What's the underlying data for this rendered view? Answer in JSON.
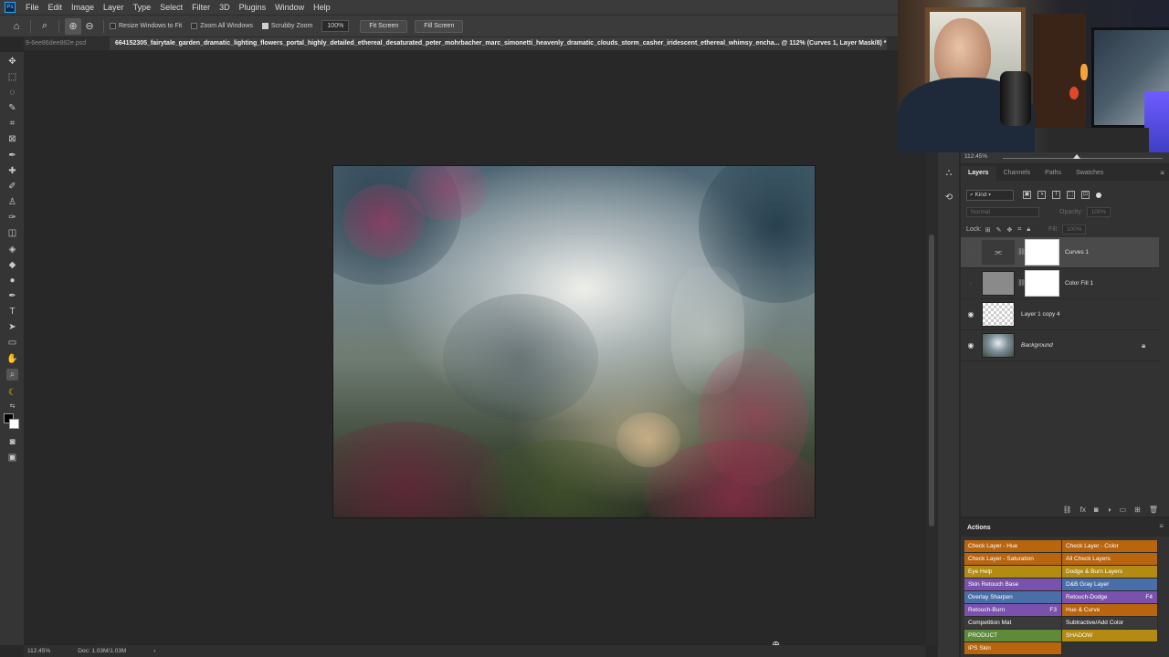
{
  "menu": [
    "File",
    "Edit",
    "Image",
    "Layer",
    "Type",
    "Select",
    "Filter",
    "3D",
    "Plugins",
    "Window",
    "Help"
  ],
  "options_bar": {
    "resize_windows": "Resize Windows to Fit",
    "zoom_all": "Zoom All Windows",
    "scrubby_zoom": "Scrubby Zoom",
    "zoom_value": "100%",
    "fit_screen": "Fit Screen",
    "fill_screen": "Fill Screen"
  },
  "tabs": {
    "inactive": "9-6ee86dee882e.psd",
    "active": "664152305_fairytale_garden_dramatic_lighting_flowers_portal_highly_detailed_ethereal_desaturated_peter_mohrbacher_marc_simonetti_heavenly_dramatic_clouds_storm_casher_iridescent_ethereal_whimsy_encha... @ 112% (Curves 1, Layer Mask/8) *"
  },
  "navigator": {
    "zoom": "112.45%"
  },
  "layers_panel": {
    "tabs": [
      "Layers",
      "Channels",
      "Paths",
      "Swatches"
    ],
    "filter_kind": "Kind",
    "blend_mode": "Normal",
    "opacity_label": "Opacity:",
    "opacity_value": "100%",
    "lock_label": "Lock:",
    "fill_label": "Fill:",
    "fill_value": "100%",
    "layers": [
      {
        "name": "Curves 1"
      },
      {
        "name": "Color Fill 1"
      },
      {
        "name": "Layer 1 copy 4"
      },
      {
        "name": "Background"
      }
    ]
  },
  "actions_panel": {
    "title": "Actions",
    "buttons": [
      {
        "label": "Check Layer - Hue",
        "key": "",
        "color": "#b8650e"
      },
      {
        "label": "Check Layer - Color",
        "key": "",
        "color": "#b8650e"
      },
      {
        "label": "Check Layer - Saturation",
        "key": "",
        "color": "#b8650e"
      },
      {
        "label": "All Check Layers",
        "key": "",
        "color": "#b8650e"
      },
      {
        "label": "Eye Help",
        "key": "",
        "color": "#b38a12"
      },
      {
        "label": "Dodge & Burn Layers",
        "key": "",
        "color": "#b38a12"
      },
      {
        "label": "Skin Retouch Base",
        "key": "",
        "color": "#7a52ad"
      },
      {
        "label": "D&B Gray Layer",
        "key": "",
        "color": "#4a6ea8"
      },
      {
        "label": "Overlay Sharpen",
        "key": "",
        "color": "#4a6ea8"
      },
      {
        "label": "Retouch-Dodge",
        "key": "F4",
        "color": "#7a52ad"
      },
      {
        "label": "Retouch-Burn",
        "key": "F3",
        "color": "#7a52ad"
      },
      {
        "label": "Hue & Curve",
        "key": "",
        "color": "#b8650e"
      },
      {
        "label": "Competition Mat",
        "key": "",
        "color": "#3a3a3a"
      },
      {
        "label": "Subtractive/Add Color",
        "key": "",
        "color": "#3a3a3a"
      },
      {
        "label": "PRODUCT",
        "key": "",
        "color": "#5f8a3a"
      },
      {
        "label": "SHADOW",
        "key": "",
        "color": "#b38a12"
      },
      {
        "label": "IPS Skin",
        "key": "",
        "color": "#b8650e"
      }
    ]
  },
  "status_bar": {
    "zoom": "112.45%",
    "doc": "Doc: 1.03M/1.03M",
    "arrow": "›"
  }
}
